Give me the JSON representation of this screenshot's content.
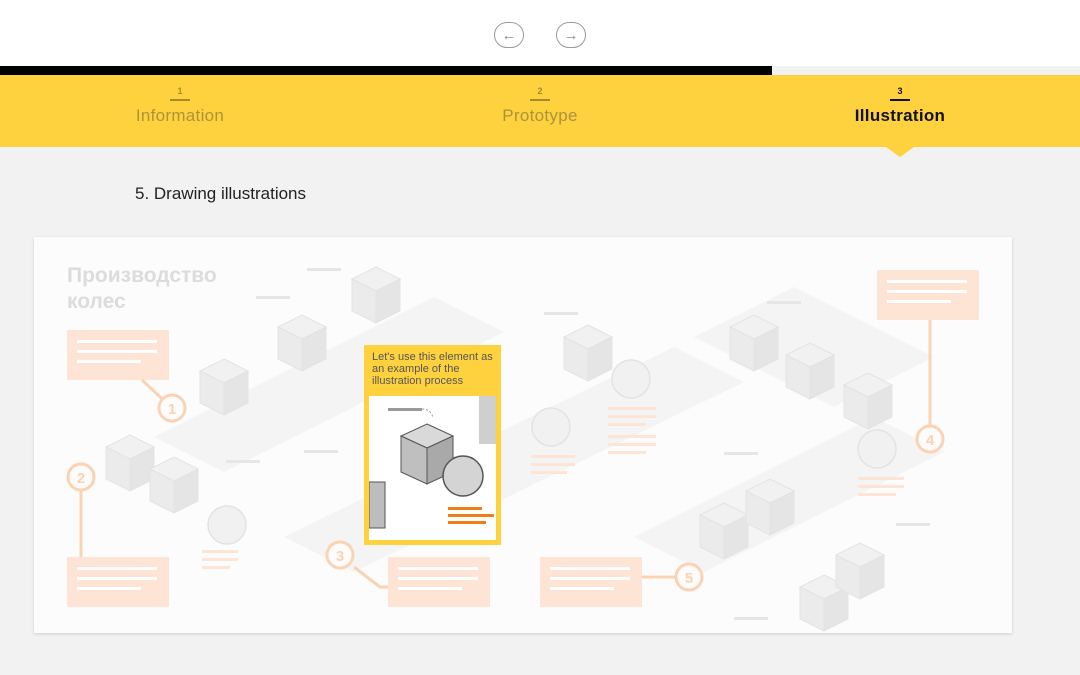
{
  "navigation": {
    "prev_icon": "arrow-left-icon",
    "next_icon": "arrow-right-icon",
    "prev_glyph": "←",
    "next_glyph": "→"
  },
  "steps": [
    {
      "number": "1",
      "label": "Information",
      "active": false
    },
    {
      "number": "2",
      "label": "Prototype",
      "active": false
    },
    {
      "number": "3",
      "label": "Illustration",
      "active": true
    }
  ],
  "section": {
    "title": "5. Drawing illustrations"
  },
  "illustration": {
    "title_line1": "Производство",
    "title_line2": "колес",
    "step_markers": [
      "1",
      "2",
      "3",
      "4",
      "5"
    ],
    "callout_text": "Let's use this element as an example of the illustration process"
  },
  "colors": {
    "accent_yellow": "#fed23f",
    "peach": "#fde4d4",
    "marker_orange": "#fbd3b3",
    "highlight_orange": "#f07d1a"
  }
}
